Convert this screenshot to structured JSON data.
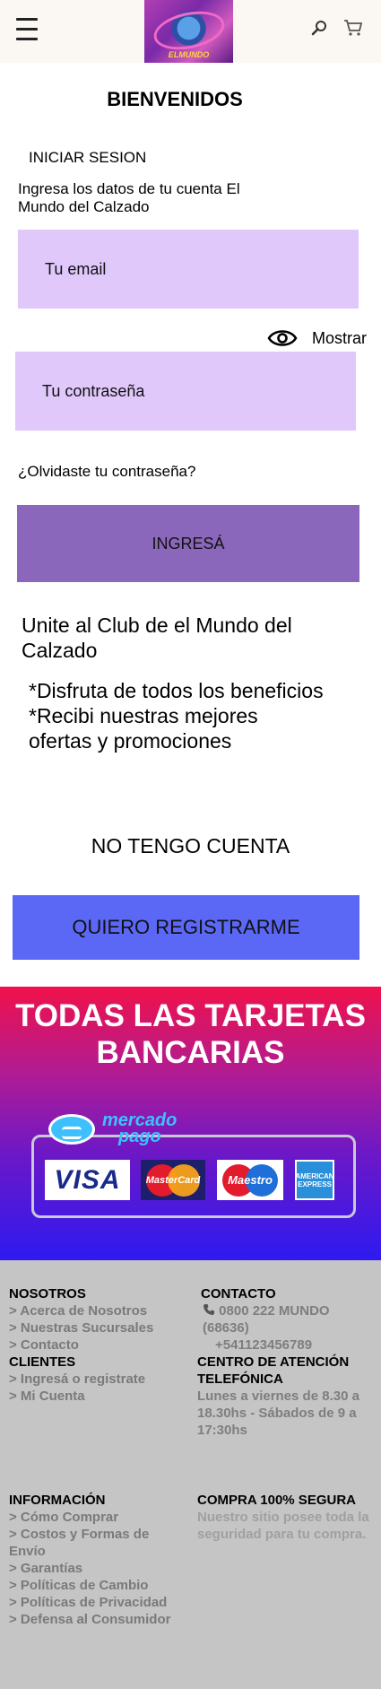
{
  "header": {
    "logo_text": "ELMUNDO"
  },
  "page": {
    "title": "BIENVENIDOS"
  },
  "login": {
    "heading": "INICIAR SESION",
    "description": "Ingresa los datos de  tu cuenta El Mundo del Calzado",
    "email_placeholder": "Tu email",
    "show_label": "Mostrar",
    "password_placeholder": "Tu contraseña",
    "forgot_label": "¿Olvidaste tu contraseña?",
    "submit_label": "INGRESÁ"
  },
  "club": {
    "title": "Unite al Club  de el Mundo del Calzado",
    "benefits": [
      "*Disfruta de todos los beneficios",
      "*Recibi nuestras mejores ofertas y promociones"
    ],
    "no_account_label": "NO TENGO CUENTA",
    "register_label": "QUIERO REGISTRARME"
  },
  "cards": {
    "title": "TODAS LAS TARJETAS BANCARIAS",
    "mercadopago_line1": "mercado",
    "mercadopago_line2": "pago",
    "visa": "VISA",
    "mastercard": "MasterCard",
    "maestro": "Maestro",
    "amex_line1": "AMERICAN",
    "amex_line2": "EXPRESS"
  },
  "footer": {
    "nosotros": {
      "heading": "NOSOTROS",
      "links": [
        "> Acerca de Nosotros",
        "> Nuestras Sucursales",
        "> Contacto"
      ]
    },
    "clientes": {
      "heading": "CLIENTES",
      "links": [
        "> Ingresá o registrate",
        "> Mi Cuenta"
      ]
    },
    "contacto": {
      "heading": "CONTACTO",
      "phone": "0800 222 MUNDO (68636)",
      "phone2": "+541123456789"
    },
    "atencion": {
      "heading": "CENTRO DE ATENCIÓN TELEFÓNICA",
      "hours": "Lunes a viernes de 8.30 a 18.30hs - Sábados de 9 a 17:30hs"
    },
    "informacion": {
      "heading": "INFORMACIÓN",
      "links": [
        "> Cómo Comprar",
        "> Costos y Formas de Envío",
        "> Garantías",
        "> Políticas de Cambio",
        "> Políticas de Privacidad",
        "> Defensa al Consumidor"
      ]
    },
    "compra": {
      "heading": "COMPRA 100% SEGURA",
      "text": "Nuestro sitio posee toda la seguridad para tu compra."
    }
  },
  "colors": {
    "input_bg": "#e0c8fb",
    "login_button": "#8b67bb",
    "register_button": "#5b68f6",
    "footer_bg": "#c5c5c5"
  }
}
